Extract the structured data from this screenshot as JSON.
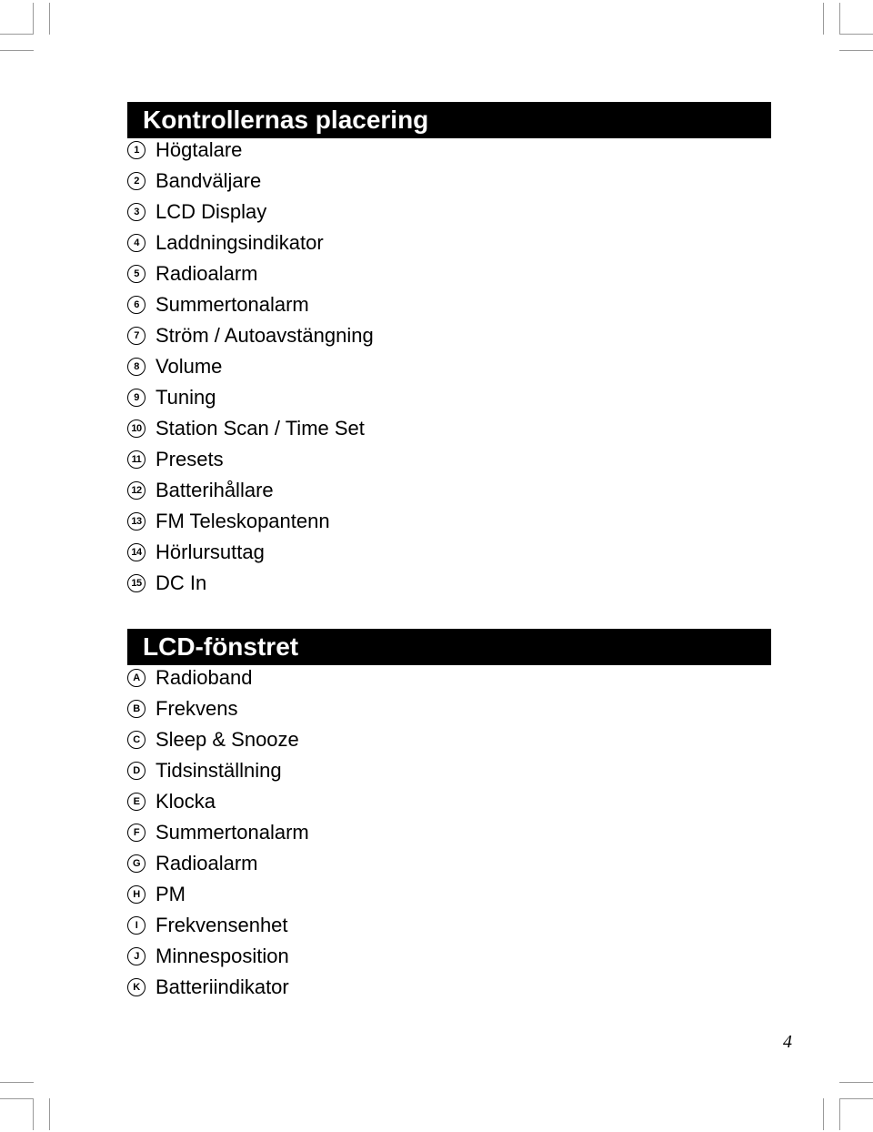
{
  "sections": {
    "controls": {
      "title": "Kontrollernas placering",
      "items": [
        {
          "marker": "1",
          "label": "Högtalare"
        },
        {
          "marker": "2",
          "label": "Bandväljare"
        },
        {
          "marker": "3",
          "label": "LCD Display"
        },
        {
          "marker": "4",
          "label": "Laddningsindikator"
        },
        {
          "marker": "5",
          "label": "Radioalarm"
        },
        {
          "marker": "6",
          "label": "Summertonalarm"
        },
        {
          "marker": "7",
          "label": "Ström / Autoavstängning"
        },
        {
          "marker": "8",
          "label": "Volume"
        },
        {
          "marker": "9",
          "label": "Tuning"
        },
        {
          "marker": "10",
          "label": "Station Scan / Time Set"
        },
        {
          "marker": "11",
          "label": "Presets"
        },
        {
          "marker": "12",
          "label": "Batterihållare"
        },
        {
          "marker": "13",
          "label": "FM Teleskopantenn"
        },
        {
          "marker": "14",
          "label": "Hörlursuttag"
        },
        {
          "marker": "15",
          "label": "DC In"
        }
      ]
    },
    "lcd": {
      "title": "LCD-fönstret",
      "items": [
        {
          "marker": "A",
          "label": "Radioband"
        },
        {
          "marker": "B",
          "label": "Frekvens"
        },
        {
          "marker": "C",
          "label": "Sleep & Snooze"
        },
        {
          "marker": "D",
          "label": "Tidsinställning"
        },
        {
          "marker": "E",
          "label": "Klocka"
        },
        {
          "marker": "F",
          "label": "Summertonalarm"
        },
        {
          "marker": "G",
          "label": "Radioalarm"
        },
        {
          "marker": "H",
          "label": "PM"
        },
        {
          "marker": "I",
          "label": "Frekvensenhet"
        },
        {
          "marker": "J",
          "label": "Minnesposition"
        },
        {
          "marker": "K",
          "label": "Batteriindikator"
        }
      ]
    }
  },
  "page_number": "4"
}
